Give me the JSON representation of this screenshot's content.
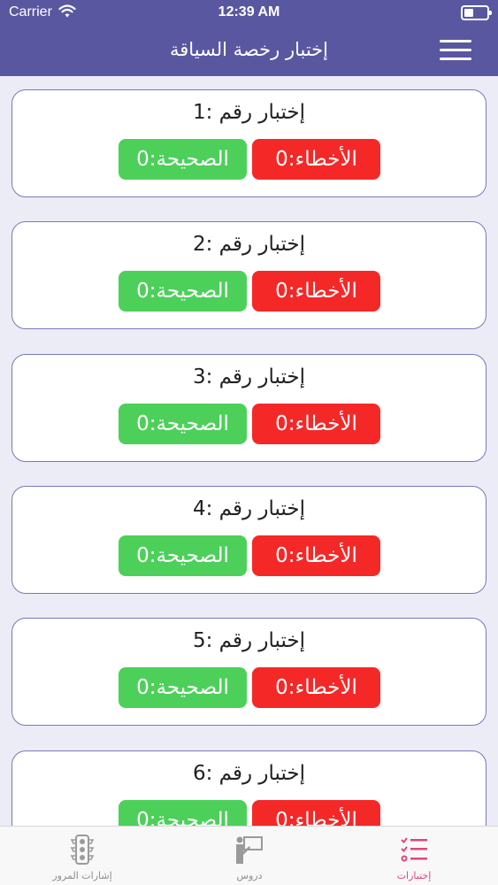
{
  "status_bar": {
    "carrier": "Carrier",
    "time": "12:39 AM"
  },
  "nav": {
    "title": "إختبار رخصة السياقة",
    "menu_icon": "hamburger-menu-icon"
  },
  "tests": [
    {
      "title": "إختبار رقم :1",
      "wrong": "الأخطاء:0",
      "correct": "الصحيحة:0"
    },
    {
      "title": "إختبار رقم :2",
      "wrong": "الأخطاء:0",
      "correct": "الصحيحة:0"
    },
    {
      "title": "إختبار رقم :3",
      "wrong": "الأخطاء:0",
      "correct": "الصحيحة:0"
    },
    {
      "title": "إختبار رقم :4",
      "wrong": "الأخطاء:0",
      "correct": "الصحيحة:0"
    },
    {
      "title": "إختبار رقم :5",
      "wrong": "الأخطاء:0",
      "correct": "الصحيحة:0"
    },
    {
      "title": "إختبار رقم :6",
      "wrong": "الأخطاء:0",
      "correct": "الصحيحة:0"
    }
  ],
  "tabs": [
    {
      "label": "إشارات المرور",
      "icon": "traffic-light-icon"
    },
    {
      "label": "دروس",
      "icon": "lesson-presenter-icon"
    },
    {
      "label": "إختبارات",
      "icon": "checklist-icon"
    }
  ],
  "colors": {
    "primary": "#5a57a1",
    "wrong": "#f52828",
    "correct": "#4cd05a",
    "active_tab": "#e0457b",
    "inactive_tab": "#8e8e93"
  }
}
